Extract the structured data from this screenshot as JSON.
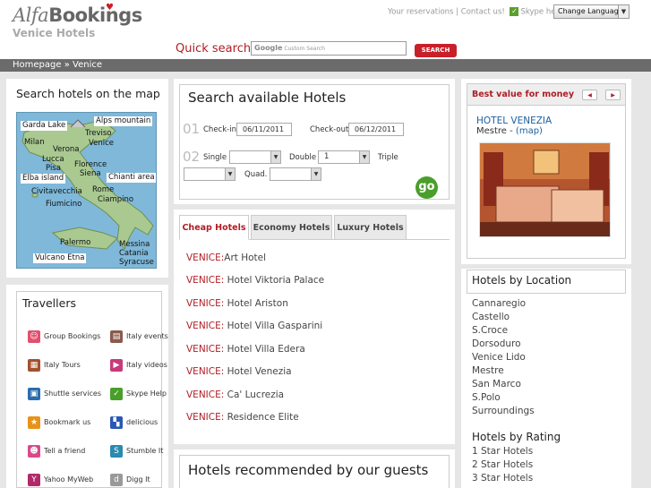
{
  "header": {
    "logo_a": "Alfa",
    "logo_b": "Bookings",
    "subtitle": "Venice Hotels",
    "link_reservations": "Your reservations",
    "link_contact": "Contact us!",
    "link_skype": "Skype help",
    "change_language": "Change Language",
    "quick_search_label": "Quick search",
    "search_google": "Google",
    "search_placeholder": "Custom Search",
    "search_button": "SEARCH"
  },
  "breadcrumb": {
    "home": "Homepage",
    "sep": "»",
    "current": "Venice"
  },
  "map": {
    "title": "Search hotels on the map",
    "labels": {
      "garda": "Garda Lake",
      "alps": "Alps mountain",
      "treviso": "Treviso",
      "milan": "Milan",
      "verona": "Verona",
      "venice": "Venice",
      "lucca": "Lucca",
      "pisa": "Pisa",
      "florence": "Florence",
      "siena": "Siena",
      "elba": "Elba island",
      "chianti": "Chianti area",
      "civitavecchia": "Civitavecchia",
      "rome": "Rome",
      "ciampino": "Ciampino",
      "fiumicino": "Fiumicino",
      "palermo": "Palermo",
      "messina": "Messina",
      "catania": "Catania",
      "vulcano": "Vulcano Etna",
      "syracuse": "Syracuse"
    }
  },
  "travellers": {
    "title": "Travellers",
    "items": [
      {
        "label": "Group Bookings",
        "icon": "group-icon",
        "color": "#e2506e"
      },
      {
        "label": "Italy events",
        "icon": "events-icon",
        "color": "#8a5a4a"
      },
      {
        "label": "Italy Tours",
        "icon": "tours-icon",
        "color": "#a0522d"
      },
      {
        "label": "Italy videos",
        "icon": "video-icon",
        "color": "#c83a7a"
      },
      {
        "label": "Shuttle services",
        "icon": "bus-icon",
        "color": "#2a6cb0"
      },
      {
        "label": "Skype Help",
        "icon": "check-icon",
        "color": "#4a9e2a"
      },
      {
        "label": "Bookmark us",
        "icon": "star-icon",
        "color": "#e8921a"
      },
      {
        "label": "delicious",
        "icon": "delicious-icon",
        "color": "#2a57b5"
      },
      {
        "label": "Tell a friend",
        "icon": "friends-icon",
        "color": "#d94a8a"
      },
      {
        "label": "Stumble It",
        "icon": "stumble-icon",
        "color": "#2a8ab0"
      },
      {
        "label": "Yahoo MyWeb",
        "icon": "yahoo-icon",
        "color": "#b02a6a"
      },
      {
        "label": "Digg It",
        "icon": "digg-icon",
        "color": "#999999"
      }
    ]
  },
  "search": {
    "title": "Search available Hotels",
    "step1": "01",
    "step2": "02",
    "checkin_label": "Check-in",
    "checkin_value": "06/11/2011",
    "checkout_label": "Check-out",
    "checkout_value": "06/12/2011",
    "single_label": "Single",
    "double_label": "Double",
    "double_value": "1",
    "triple_label": "Triple",
    "quad_label": "Quad.",
    "go": "go"
  },
  "tabs": [
    "Cheap Hotels",
    "Economy Hotels",
    "Luxury Hotels"
  ],
  "hotels": [
    {
      "city": "VENICE:",
      "name": "Art Hotel"
    },
    {
      "city": "VENICE:",
      "name": " Hotel Viktoria Palace"
    },
    {
      "city": "VENICE:",
      "name": " Hotel Ariston"
    },
    {
      "city": "VENICE:",
      "name": " Hotel Villa Gasparini"
    },
    {
      "city": "VENICE:",
      "name": " Hotel Villa Edera"
    },
    {
      "city": "VENICE:",
      "name": " Hotel Venezia"
    },
    {
      "city": "VENICE:",
      "name": " Ca' Lucrezia"
    },
    {
      "city": "VENICE:",
      "name": " Residence Elite"
    }
  ],
  "recommended": {
    "title": "Hotels recommended by our guests"
  },
  "best_value": {
    "title": "Best value for money",
    "hotel": "HOTEL VENEZIA",
    "location": "Mestre - ",
    "map_link": "(map)"
  },
  "location": {
    "title": "Hotels by Location",
    "items": [
      "Cannaregio",
      "Castello",
      "S.Croce",
      "Dorsoduro",
      "Venice Lido",
      "Mestre",
      "San Marco",
      "S.Polo",
      "Surroundings"
    ],
    "rating_title": "Hotels by Rating",
    "ratings": [
      "1 Star Hotels",
      "2 Star Hotels",
      "3 Star Hotels"
    ]
  },
  "colors": {
    "brand_red": "#b01d25",
    "link_blue": "#1d5fa0",
    "breadcrumb_bar": "#6b6b6b"
  }
}
